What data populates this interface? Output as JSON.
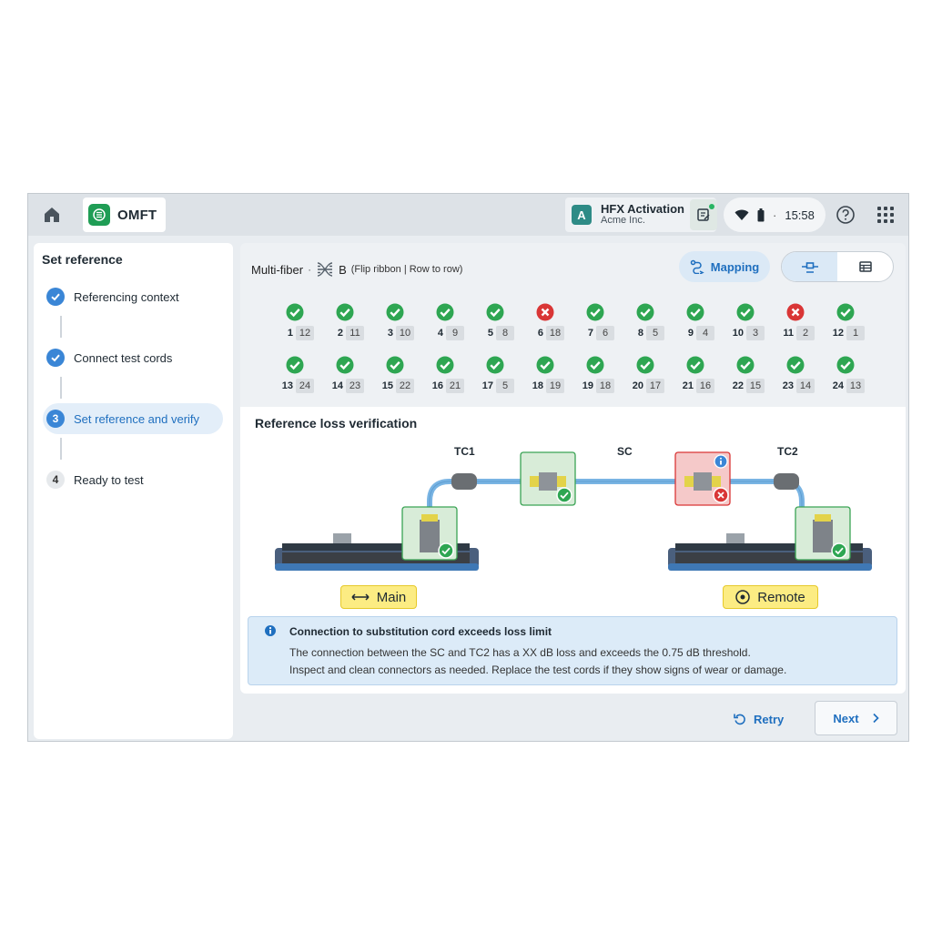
{
  "topbar": {
    "app_name": "OMFT",
    "account_initial": "A",
    "account_title": "HFX Activation",
    "account_sub": "Acme Inc.",
    "time": "15:58",
    "time_dot": "·"
  },
  "sidebar": {
    "title": "Set reference",
    "steps": [
      {
        "label": "Referencing context",
        "state": "done"
      },
      {
        "label": "Connect test cords",
        "state": "done"
      },
      {
        "label": "Set reference and verify",
        "state": "current",
        "number": "3"
      },
      {
        "label": "Ready to test",
        "state": "pending",
        "number": "4"
      }
    ]
  },
  "fiber": {
    "mode_label": "Multi-fiber",
    "separator": "·",
    "polarity": "B",
    "polarity_desc": "(Flip ribbon | Row to row)",
    "mapping_label": "Mapping",
    "row1": [
      {
        "n": "1",
        "p": "12",
        "ok": true
      },
      {
        "n": "2",
        "p": "11",
        "ok": true
      },
      {
        "n": "3",
        "p": "10",
        "ok": true
      },
      {
        "n": "4",
        "p": "9",
        "ok": true
      },
      {
        "n": "5",
        "p": "8",
        "ok": true
      },
      {
        "n": "6",
        "p": "18",
        "ok": false
      },
      {
        "n": "7",
        "p": "6",
        "ok": true
      },
      {
        "n": "8",
        "p": "5",
        "ok": true
      },
      {
        "n": "9",
        "p": "4",
        "ok": true
      },
      {
        "n": "10",
        "p": "3",
        "ok": true
      },
      {
        "n": "11",
        "p": "2",
        "ok": false
      },
      {
        "n": "12",
        "p": "1",
        "ok": true
      }
    ],
    "row2": [
      {
        "n": "13",
        "p": "24",
        "ok": true
      },
      {
        "n": "14",
        "p": "23",
        "ok": true
      },
      {
        "n": "15",
        "p": "22",
        "ok": true
      },
      {
        "n": "16",
        "p": "21",
        "ok": true
      },
      {
        "n": "17",
        "p": "5",
        "ok": true
      },
      {
        "n": "18",
        "p": "19",
        "ok": true
      },
      {
        "n": "19",
        "p": "18",
        "ok": true
      },
      {
        "n": "20",
        "p": "17",
        "ok": true
      },
      {
        "n": "21",
        "p": "16",
        "ok": true
      },
      {
        "n": "22",
        "p": "15",
        "ok": true
      },
      {
        "n": "23",
        "p": "14",
        "ok": true
      },
      {
        "n": "24",
        "p": "13",
        "ok": true
      }
    ]
  },
  "reference": {
    "title": "Reference loss verification",
    "tc1": "TC1",
    "sc": "SC",
    "tc2": "TC2",
    "main_label": "Main",
    "remote_label": "Remote",
    "alert_title": "Connection to substitution cord exceeds loss limit",
    "alert_line1": "The connection between the SC and TC2 has a XX dB loss and exceeds the 0.75 dB threshold.",
    "alert_line2": "Inspect and clean connectors as needed. Replace the test cords if they show signs of wear or damage."
  },
  "actions": {
    "retry": "Retry",
    "next": "Next"
  },
  "colors": {
    "accent": "#1f6fbf",
    "ok": "#2ea652",
    "error": "#d93636",
    "cable": "#79b4e3",
    "highlight": "#fcec83"
  }
}
